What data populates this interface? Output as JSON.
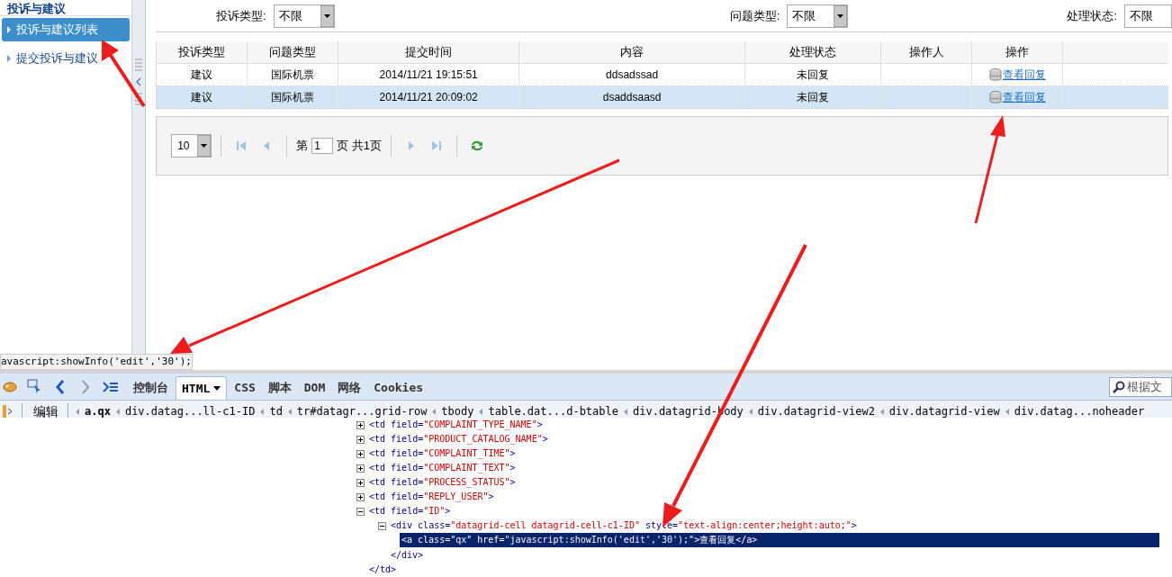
{
  "sidebar": {
    "header": "投诉与建议",
    "items": [
      {
        "label": "投诉与建议列表",
        "selected": true
      },
      {
        "label": "提交投诉与建议",
        "selected": false
      }
    ]
  },
  "filters": [
    {
      "label": "投诉类型:",
      "value": "不限"
    },
    {
      "label": "问题类型:",
      "value": "不限"
    },
    {
      "label": "处理状态:",
      "value": "不限"
    }
  ],
  "table": {
    "columns": [
      "投诉类型",
      "问题类型",
      "提交时间",
      "内容",
      "处理状态",
      "操作人",
      "操作"
    ],
    "rows": [
      {
        "cells": [
          "建议",
          "国际机票",
          "2014/11/21 19:15:51",
          "ddsadssad",
          "未回复",
          ""
        ],
        "action": "查看回复",
        "selected": false
      },
      {
        "cells": [
          "建议",
          "国际机票",
          "2014/11/21 20:09:02",
          "dsaddsaasd",
          "未回复",
          ""
        ],
        "action": "查看回复",
        "selected": true
      }
    ]
  },
  "pager": {
    "page_size": "10",
    "page_prefix": "第",
    "page": "1",
    "page_suffix": "页 共1页"
  },
  "status_text": "avascript:showInfo('edit','30');",
  "devtools": {
    "tabs": [
      {
        "label": "控制台",
        "selected": false,
        "caret": false
      },
      {
        "label": "HTML",
        "selected": true,
        "caret": true
      },
      {
        "label": "CSS",
        "selected": false,
        "caret": false
      },
      {
        "label": "脚本",
        "selected": false,
        "caret": false
      },
      {
        "label": "DOM",
        "selected": false,
        "caret": false
      },
      {
        "label": "网络",
        "selected": false,
        "caret": false
      },
      {
        "label": "Cookies",
        "selected": false,
        "caret": false
      }
    ],
    "search_placeholder": "根据文",
    "edit_label": "编辑",
    "breadcrumbs": [
      {
        "label": "a.qx",
        "selected": true
      },
      {
        "label": "div.datag...ll-c1-ID",
        "selected": false
      },
      {
        "label": "td",
        "selected": false
      },
      {
        "label": "tr#datagr...grid-row",
        "selected": false
      },
      {
        "label": "tbody",
        "selected": false
      },
      {
        "label": "table.dat...d-btable",
        "selected": false
      },
      {
        "label": "div.datagrid-body",
        "selected": false
      },
      {
        "label": "div.datagrid-view2",
        "selected": false
      },
      {
        "label": "div.datagrid-view",
        "selected": false
      },
      {
        "label": "div.datag...noheader",
        "selected": false
      }
    ],
    "tree": [
      {
        "expanded": false,
        "parts": [
          {
            "kind": "tag",
            "text": "<td field="
          },
          {
            "kind": "value",
            "text": "\"COMPLAINT_TYPE_NAME\""
          },
          {
            "kind": "tag",
            "text": ">"
          }
        ]
      },
      {
        "expanded": false,
        "parts": [
          {
            "kind": "tag",
            "text": "<td field="
          },
          {
            "kind": "value",
            "text": "\"PRODUCT_CATALOG_NAME\""
          },
          {
            "kind": "tag",
            "text": ">"
          }
        ]
      },
      {
        "expanded": false,
        "parts": [
          {
            "kind": "tag",
            "text": "<td field="
          },
          {
            "kind": "value",
            "text": "\"COMPLAINT_TIME\""
          },
          {
            "kind": "tag",
            "text": ">"
          }
        ]
      },
      {
        "expanded": false,
        "parts": [
          {
            "kind": "tag",
            "text": "<td field="
          },
          {
            "kind": "value",
            "text": "\"COMPLAINT_TEXT\""
          },
          {
            "kind": "tag",
            "text": ">"
          }
        ]
      },
      {
        "expanded": false,
        "parts": [
          {
            "kind": "tag",
            "text": "<td field="
          },
          {
            "kind": "value",
            "text": "\"PROCESS_STATUS\""
          },
          {
            "kind": "tag",
            "text": ">"
          }
        ]
      },
      {
        "expanded": false,
        "parts": [
          {
            "kind": "tag",
            "text": "<td field="
          },
          {
            "kind": "value",
            "text": "\"REPLY_USER\""
          },
          {
            "kind": "tag",
            "text": ">"
          }
        ]
      },
      {
        "expanded": true,
        "parts": [
          {
            "kind": "tag",
            "text": "<td field="
          },
          {
            "kind": "value",
            "text": "\"ID\""
          },
          {
            "kind": "tag",
            "text": ">"
          }
        ],
        "close": "</td>",
        "children": [
          {
            "expanded": true,
            "parts": [
              {
                "kind": "tag",
                "text": "<div class="
              },
              {
                "kind": "value",
                "text": "\"datagrid-cell datagrid-cell-c1-ID\""
              },
              {
                "kind": "tag",
                "text": " style="
              },
              {
                "kind": "value",
                "text": "\"text-align:center;height:auto;\""
              },
              {
                "kind": "tag",
                "text": ">"
              }
            ],
            "close": "</div>",
            "children": [
              {
                "leaf": true,
                "selected": true,
                "parts": [
                  {
                    "kind": "tag",
                    "text": "<a class="
                  },
                  {
                    "kind": "value",
                    "text": "\"qx\""
                  },
                  {
                    "kind": "tag",
                    "text": " href="
                  },
                  {
                    "kind": "value",
                    "text": "\"javascript:showInfo('edit','30');\""
                  },
                  {
                    "kind": "tag",
                    "text": ">"
                  },
                  {
                    "kind": "text",
                    "text": "查看回复"
                  },
                  {
                    "kind": "tag",
                    "text": "</a>"
                  }
                ]
              }
            ]
          }
        ]
      }
    ]
  }
}
